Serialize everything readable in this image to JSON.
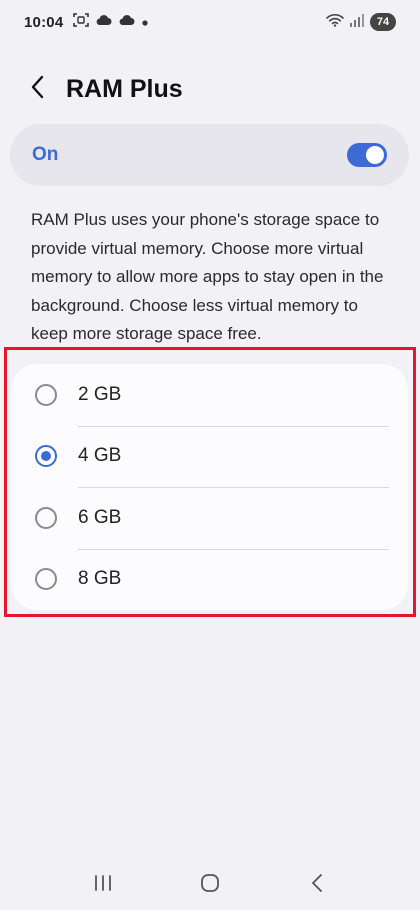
{
  "status_bar": {
    "time": "10:04",
    "battery": "74",
    "icons": [
      "screenshot-icon",
      "cloud-icon",
      "cloud-icon",
      "dot-icon",
      "wifi-icon",
      "signal-icon"
    ]
  },
  "header": {
    "title": "RAM Plus",
    "back_icon": "chevron-left-icon"
  },
  "master_switch": {
    "label": "On",
    "state": true,
    "accent_color": "#3d6ad6"
  },
  "description": "RAM Plus uses your phone's storage space to provide virtual memory. Choose more virtual memory to allow more apps to stay open in the background. Choose less virtual memory to keep more storage space free.",
  "options": [
    {
      "label": "2 GB",
      "selected": false
    },
    {
      "label": "4 GB",
      "selected": true
    },
    {
      "label": "6 GB",
      "selected": false
    },
    {
      "label": "8 GB",
      "selected": false
    }
  ],
  "highlight_color": "#e2182a",
  "nav_bar": {
    "items": [
      "recents-icon",
      "home-icon",
      "back-icon"
    ]
  }
}
